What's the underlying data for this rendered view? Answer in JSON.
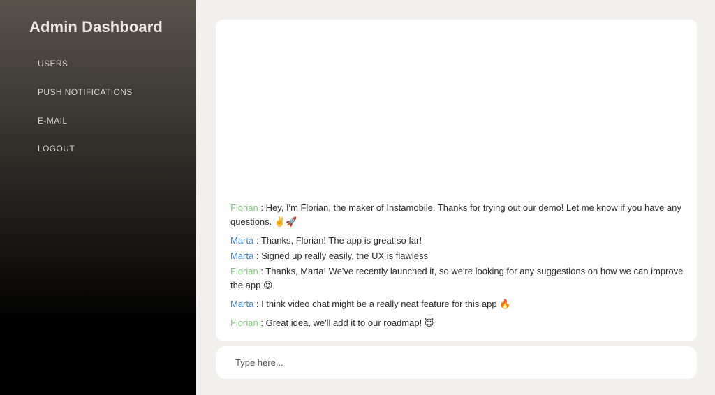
{
  "sidebar": {
    "title": "Admin Dashboard",
    "items": [
      {
        "label": "USERS"
      },
      {
        "label": "PUSH NOTIFICATIONS"
      },
      {
        "label": "E-MAIL"
      },
      {
        "label": "LOGOUT"
      }
    ]
  },
  "chat": {
    "messages": [
      {
        "sender": "Florian",
        "separator": " : ",
        "text": "Hey, I'm Florian, the maker of Instamobile. Thanks for trying out our demo! Let me know if you have any questions. ",
        "emoji": "✌️🚀"
      },
      {
        "sender": "Marta",
        "separator": " : ",
        "text": "Thanks, Florian! The app is great so far!",
        "emoji": ""
      },
      {
        "sender": "Marta",
        "separator": " : ",
        "text": "Signed up really easily, the UX is flawless",
        "emoji": ""
      },
      {
        "sender": "Florian",
        "separator": " : ",
        "text": "Thanks, Marta! We've recently launched it, so we're looking for any suggestions on how we can improve the app ",
        "emoji": "😍"
      },
      {
        "sender": "Marta",
        "separator": " : ",
        "text": "I think video chat might be a really neat feature for this app ",
        "emoji": "🔥"
      },
      {
        "sender": "Florian",
        "separator": " : ",
        "text": "Great idea, we'll add it to our roadmap! ",
        "emoji": "😇"
      }
    ],
    "input": {
      "placeholder": "Type here...",
      "value": ""
    }
  },
  "colors": {
    "florian": "#7ec87a",
    "marta": "#3d86d8",
    "background": "#f1f0ec",
    "card": "#ffffff"
  }
}
